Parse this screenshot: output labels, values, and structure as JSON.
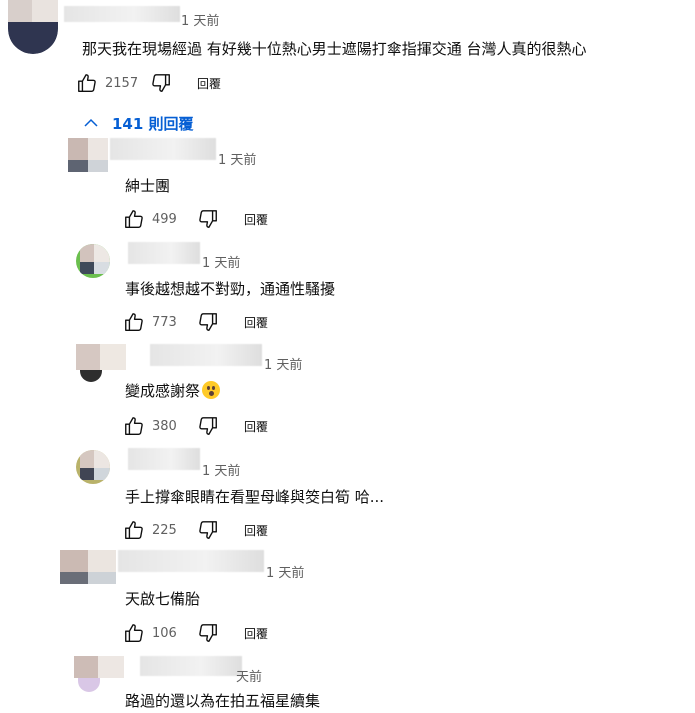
{
  "top_comment": {
    "time": "1 天前",
    "text": "那天我在現場經過 有好幾十位熱心男士遮陽打傘指揮交通 台灣人真的很熱心",
    "likes": "2157",
    "reply_label": "回覆"
  },
  "replies_toggle": {
    "label": "141 則回覆",
    "icon": "chevron-up-icon"
  },
  "replies": [
    {
      "time": "1 天前",
      "text": "紳士團",
      "likes": "499",
      "reply_label": "回覆"
    },
    {
      "time": "1 天前",
      "text": "事後越想越不對勁，通通性騷擾",
      "likes": "773",
      "reply_label": "回覆"
    },
    {
      "time": "1 天前",
      "text": "變成感謝祭",
      "likes": "380",
      "reply_label": "回覆",
      "emoji": "astonished-face-emoji"
    },
    {
      "time": "1 天前",
      "text": "手上撐傘眼睛在看聖母峰與筊白筍 哈...",
      "likes": "225",
      "reply_label": "回覆"
    },
    {
      "time": "1 天前",
      "text": "天啟七備胎",
      "likes": "106",
      "reply_label": "回覆"
    },
    {
      "time": "天前",
      "text": "路過的還以為在拍五福星續集"
    }
  ],
  "icons": {
    "like": "thumbs-up-icon",
    "dislike": "thumbs-down-icon"
  },
  "colors": {
    "link_blue": "#065fd4",
    "secondary_text": "#606060"
  }
}
